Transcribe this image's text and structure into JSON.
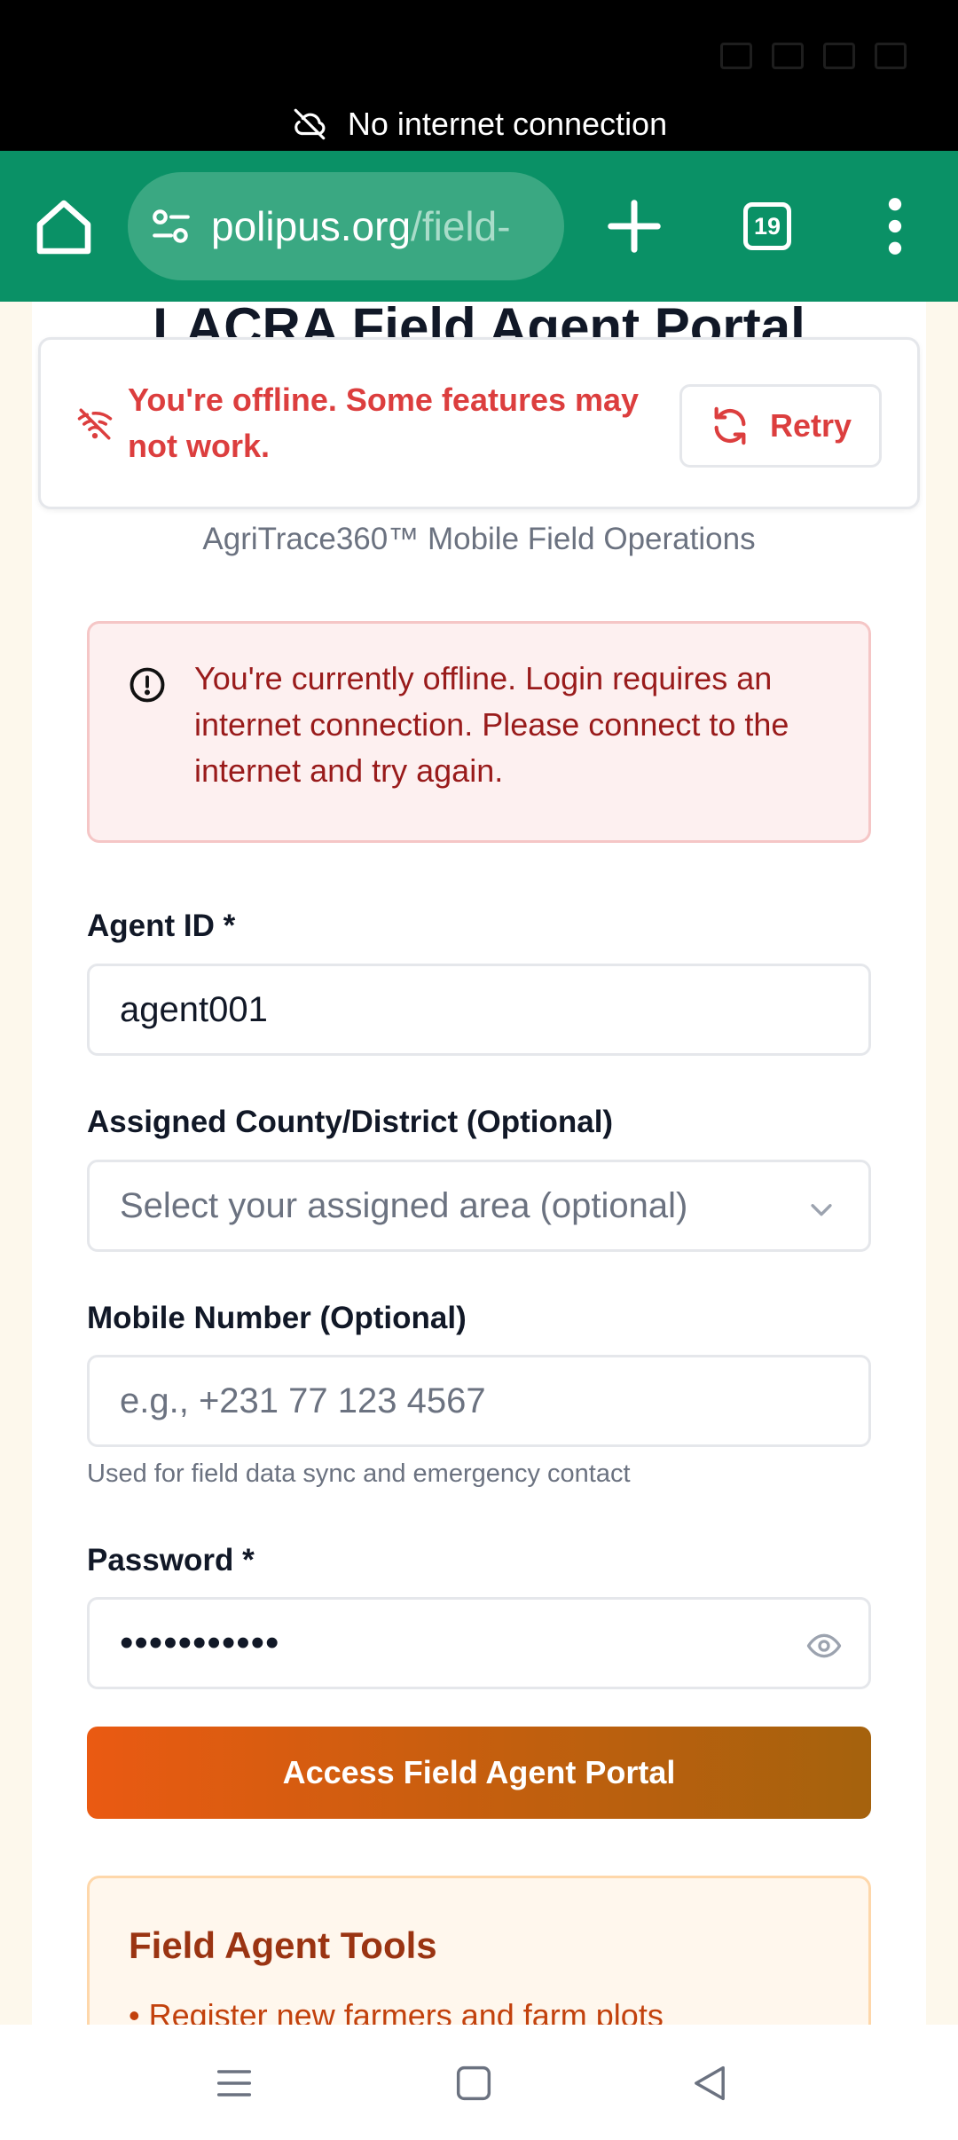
{
  "system": {
    "connectivity_banner": "No internet connection"
  },
  "browser": {
    "url_host": "polipus.org",
    "url_path": "/field-",
    "tab_count": "19"
  },
  "page": {
    "title": "LACRA Field Agent Portal",
    "subtitle": "AgriTrace360™ Mobile Field Operations"
  },
  "offline_toast": {
    "message": "You're offline. Some features may not work.",
    "retry_label": "Retry"
  },
  "alert": {
    "message": "You're currently offline. Login requires an internet connection. Please connect to the internet and try again."
  },
  "form": {
    "agent_id": {
      "label": "Agent ID *",
      "value": "agent001"
    },
    "county": {
      "label": "Assigned County/District (Optional)",
      "placeholder": "Select your assigned area (optional)"
    },
    "mobile": {
      "label": "Mobile Number (Optional)",
      "placeholder": "e.g., +231 77 123 4567",
      "helper": "Used for field data sync and emergency contact"
    },
    "password": {
      "label": "Password *",
      "masked_value": "•••••••••••"
    },
    "submit_label": "Access Field Agent Portal"
  },
  "tools": {
    "title": "Field Agent Tools",
    "items": [
      "• Register new farmers and farm plots"
    ]
  },
  "colors": {
    "browser_bar": "#0a9166",
    "error_red": "#dc3e3e",
    "button_start": "#ea5a12",
    "button_end": "#a5620d"
  }
}
